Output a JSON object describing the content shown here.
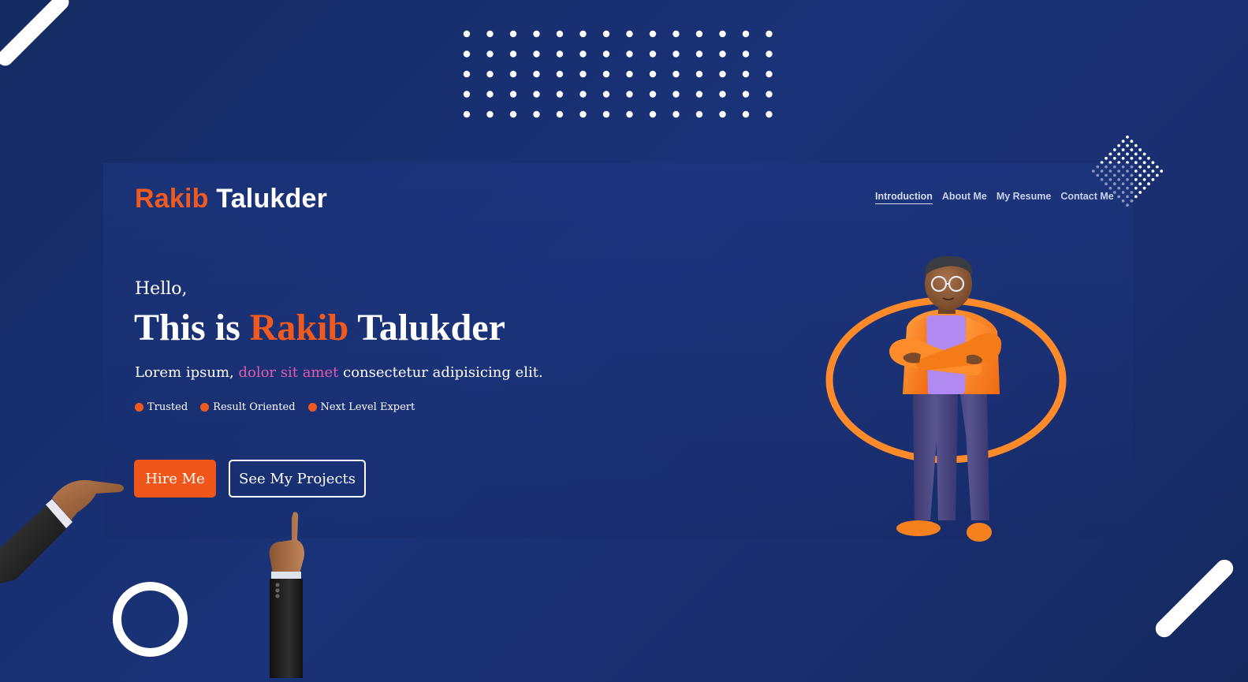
{
  "brand": {
    "first": "Rakib",
    "last": "Talukder"
  },
  "nav": [
    {
      "label": "Introduction",
      "active": true
    },
    {
      "label": "About Me"
    },
    {
      "label": "My Resume"
    },
    {
      "label": "Contact Me"
    }
  ],
  "hero": {
    "greeting": "Hello,",
    "headline_prefix": "This is ",
    "headline_accent": "Rakib",
    "headline_suffix": " Talukder",
    "sub_prefix": "Lorem ipsum, ",
    "sub_highlight": "dolor sit amet",
    "sub_suffix": " consectetur adipisicing elit.",
    "tags": [
      "Trusted",
      "Result Oriented",
      "Next Level Expert"
    ],
    "primary_button": "Hire Me",
    "secondary_button": "See My Projects"
  },
  "colors": {
    "accent": "#f05a1e",
    "highlight": "#e05cb0",
    "background": "#1a3278"
  },
  "icons": [
    "pointing-hand-icon",
    "raised-finger-hand-icon",
    "avatar-illustration"
  ]
}
